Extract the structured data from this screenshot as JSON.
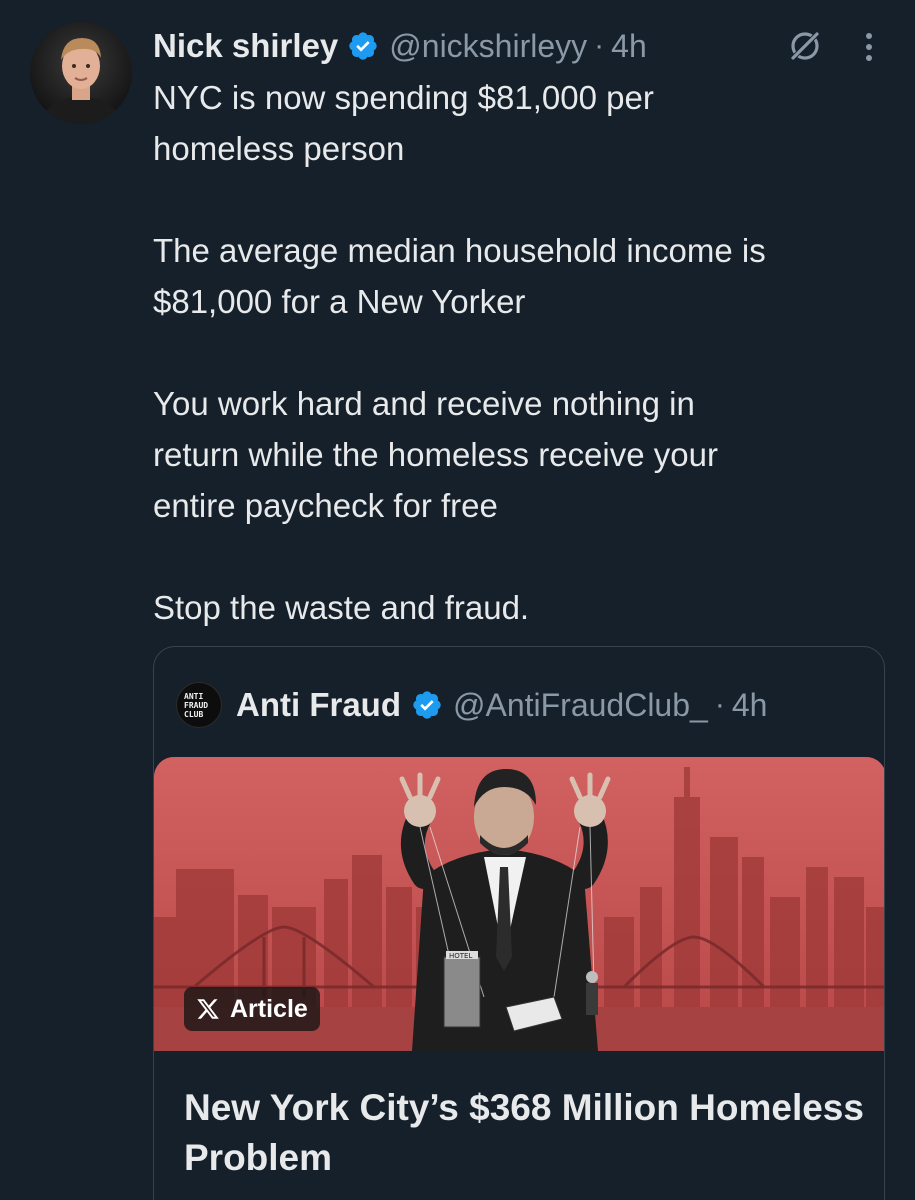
{
  "tweet": {
    "author_name": "Nick shirley",
    "author_handle": "@nickshirleyy",
    "separator": "·",
    "time": "4h",
    "paragraphs": [
      "NYC is now spending $81,000 per\nhomeless person",
      "The average median household income is\n$81,000 for a New Yorker",
      "You work hard and receive nothing in\nreturn while the homeless receive your\nentire paycheck for free",
      "Stop the waste and fraud."
    ]
  },
  "quote": {
    "author_name": "Anti Fraud",
    "author_handle": "@AntiFraudClub_",
    "separator": "·",
    "time": "4h",
    "avatar_text": [
      "ANTI",
      "FRAUD",
      "CLUB"
    ],
    "badge_label": "Article",
    "image_sign": "HOTEL",
    "article_title": "New York City’s $368 Million Homeless Problem"
  },
  "colors": {
    "background": "#15202b",
    "text": "#e7e9ea",
    "muted": "#8b98a5",
    "verified": "#1d9bf0",
    "image_red": "#c85656"
  },
  "icons": [
    "verified-badge-icon",
    "grok-icon",
    "more-options-icon",
    "x-logo-icon"
  ]
}
